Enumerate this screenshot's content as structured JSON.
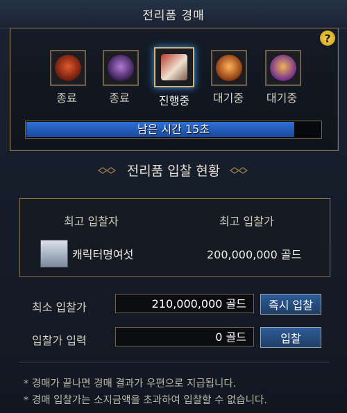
{
  "window": {
    "title": "전리품 경매"
  },
  "help": {
    "label": "?"
  },
  "items": [
    {
      "status": "종료",
      "icon": "red-emblem-icon"
    },
    {
      "status": "종료",
      "icon": "purple-emblem-icon"
    },
    {
      "status": "진행중",
      "icon": "warrior-portrait-icon"
    },
    {
      "status": "대기중",
      "icon": "orange-creature-icon"
    },
    {
      "status": "대기중",
      "icon": "armored-creature-icon"
    }
  ],
  "timer": {
    "text": "남은 시간 15초",
    "progress": 0.91
  },
  "bids": {
    "title": "전리품 입찰 현황",
    "header_bidder": "최고 입찰자",
    "header_amount": "최고 입찰가",
    "top_bidder": "캐릭터명여섯",
    "top_amount": "200,000,000 골드"
  },
  "form": {
    "min_bid_label": "최소 입찰가",
    "min_bid_value": "210,000,000 골드",
    "instant_bid_button": "즉시 입찰",
    "bid_input_label": "입찰가 입력",
    "bid_input_value": "0 골드",
    "bid_button": "입찰"
  },
  "notes": [
    "* 경매가 끝나면 경매 결과가 우편으로 지급됩니다.",
    "* 경매 입찰가는 소지금액을 초과하여 입찰할 수 없습니다."
  ],
  "colors": {
    "accent_gold": "#8b7348",
    "bar_blue": "#2e6fd6"
  }
}
